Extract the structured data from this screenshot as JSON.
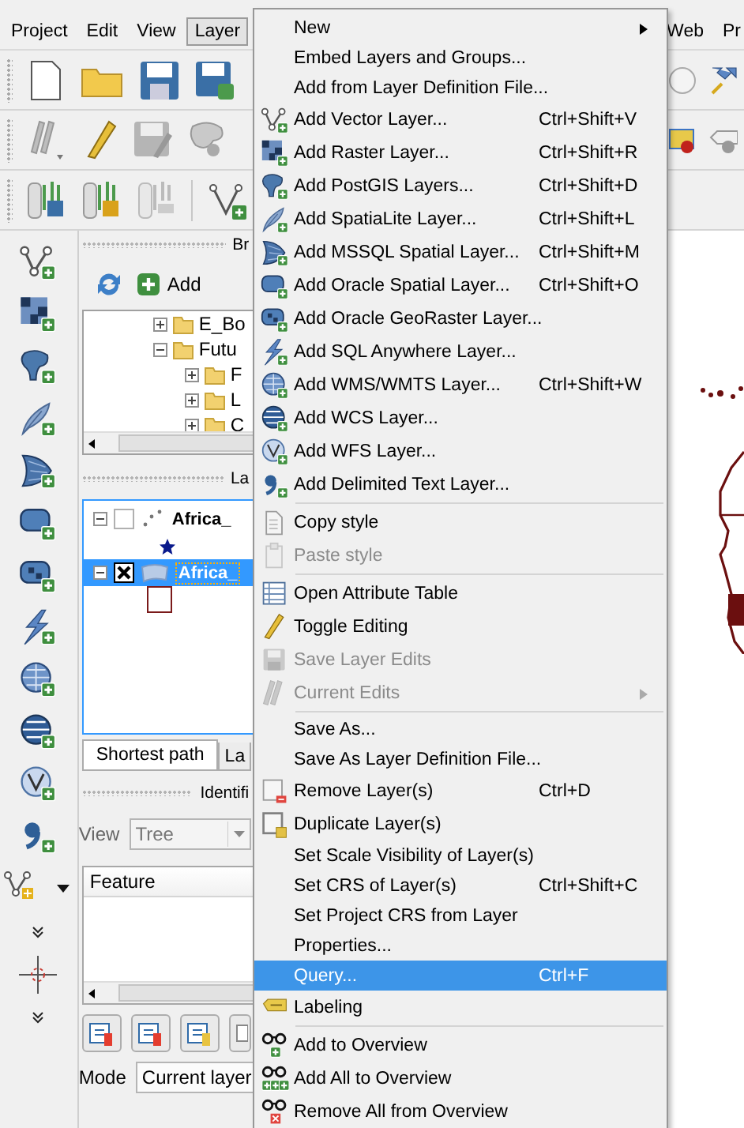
{
  "menubar": [
    {
      "label": "Project",
      "selected": false
    },
    {
      "label": "Edit",
      "selected": false
    },
    {
      "label": "View",
      "selected": false
    },
    {
      "label": "Layer",
      "selected": true
    },
    {
      "label": "Web",
      "selected": false
    },
    {
      "label": "Pr",
      "selected": false
    }
  ],
  "browser_panel": {
    "title": "Br",
    "add_button": "Add",
    "tree": [
      {
        "label": "E_Bo",
        "expanded": false
      },
      {
        "label": "Futu",
        "expanded": true,
        "children": [
          {
            "label": "F",
            "expanded": false
          },
          {
            "label": "L",
            "expanded": false
          },
          {
            "label": "C",
            "expanded": false
          }
        ]
      }
    ]
  },
  "layers_panel": {
    "title": "La",
    "layers": [
      {
        "label": "Africa_",
        "kind": "point",
        "checked": false,
        "selected": false
      },
      {
        "label": "Africa_",
        "kind": "polygon",
        "checked": true,
        "selected": true
      }
    ]
  },
  "dock_tabs": [
    {
      "label": "Shortest path",
      "selected": true
    },
    {
      "label": "La",
      "selected": false
    }
  ],
  "identify_panel": {
    "title": "Identifi",
    "view_label": "View",
    "view_value": "Tree",
    "table_header": "Feature",
    "mode_label": "Mode",
    "mode_value": "Current layer"
  },
  "layer_menu": [
    {
      "kind": "item",
      "label": "New",
      "disabled": false,
      "selected": false,
      "submenu": true
    },
    {
      "kind": "item",
      "label": "Embed Layers and Groups...",
      "disabled": false,
      "selected": false,
      "submenu": false
    },
    {
      "kind": "item",
      "label": "Add from Layer Definition File...",
      "disabled": false,
      "selected": false,
      "submenu": false
    },
    {
      "kind": "item",
      "label": "Add Vector Layer...",
      "shortcut": "Ctrl+Shift+V",
      "disabled": false,
      "selected": false,
      "submenu": false
    },
    {
      "kind": "item",
      "label": "Add Raster Layer...",
      "shortcut": "Ctrl+Shift+R",
      "disabled": false,
      "selected": false,
      "submenu": false
    },
    {
      "kind": "item",
      "label": "Add PostGIS Layers...",
      "shortcut": "Ctrl+Shift+D",
      "disabled": false,
      "selected": false,
      "submenu": false
    },
    {
      "kind": "item",
      "label": "Add SpatiaLite Layer...",
      "shortcut": "Ctrl+Shift+L",
      "disabled": false,
      "selected": false,
      "submenu": false
    },
    {
      "kind": "item",
      "label": "Add MSSQL Spatial Layer...",
      "shortcut": "Ctrl+Shift+M",
      "disabled": false,
      "selected": false,
      "submenu": false
    },
    {
      "kind": "item",
      "label": "Add Oracle Spatial Layer...",
      "shortcut": "Ctrl+Shift+O",
      "disabled": false,
      "selected": false,
      "submenu": false
    },
    {
      "kind": "item",
      "label": "Add Oracle GeoRaster Layer...",
      "disabled": false,
      "selected": false,
      "submenu": false
    },
    {
      "kind": "item",
      "label": "Add SQL Anywhere Layer...",
      "disabled": false,
      "selected": false,
      "submenu": false
    },
    {
      "kind": "item",
      "label": "Add WMS/WMTS Layer...",
      "shortcut": "Ctrl+Shift+W",
      "disabled": false,
      "selected": false,
      "submenu": false
    },
    {
      "kind": "item",
      "label": "Add WCS Layer...",
      "disabled": false,
      "selected": false,
      "submenu": false
    },
    {
      "kind": "item",
      "label": "Add WFS Layer...",
      "disabled": false,
      "selected": false,
      "submenu": false
    },
    {
      "kind": "item",
      "label": "Add Delimited Text Layer...",
      "disabled": false,
      "selected": false,
      "submenu": false
    },
    {
      "kind": "separator"
    },
    {
      "kind": "item",
      "label": "Copy style",
      "disabled": false,
      "selected": false,
      "submenu": false
    },
    {
      "kind": "item",
      "label": "Paste style",
      "disabled": true,
      "selected": false,
      "submenu": false
    },
    {
      "kind": "separator"
    },
    {
      "kind": "item",
      "label": "Open Attribute Table",
      "disabled": false,
      "selected": false,
      "submenu": false
    },
    {
      "kind": "item",
      "label": "Toggle Editing",
      "disabled": false,
      "selected": false,
      "submenu": false
    },
    {
      "kind": "item",
      "label": "Save Layer Edits",
      "disabled": true,
      "selected": false,
      "submenu": false
    },
    {
      "kind": "item",
      "label": "Current Edits",
      "disabled": true,
      "selected": false,
      "submenu": true
    },
    {
      "kind": "separator"
    },
    {
      "kind": "item",
      "label": "Save As...",
      "disabled": false,
      "selected": false,
      "submenu": false
    },
    {
      "kind": "item",
      "label": "Save As Layer Definition File...",
      "disabled": false,
      "selected": false,
      "submenu": false
    },
    {
      "kind": "item",
      "label": "Remove Layer(s)",
      "shortcut": "Ctrl+D",
      "disabled": false,
      "selected": false,
      "submenu": false
    },
    {
      "kind": "item",
      "label": "Duplicate Layer(s)",
      "disabled": false,
      "selected": false,
      "submenu": false
    },
    {
      "kind": "item",
      "label": "Set Scale Visibility of Layer(s)",
      "disabled": false,
      "selected": false,
      "submenu": false
    },
    {
      "kind": "item",
      "label": "Set CRS of Layer(s)",
      "shortcut": "Ctrl+Shift+C",
      "disabled": false,
      "selected": false,
      "submenu": false
    },
    {
      "kind": "item",
      "label": "Set Project CRS from Layer",
      "disabled": false,
      "selected": false,
      "submenu": false
    },
    {
      "kind": "item",
      "label": "Properties...",
      "disabled": false,
      "selected": false,
      "submenu": false
    },
    {
      "kind": "item",
      "label": "Query...",
      "shortcut": "Ctrl+F",
      "disabled": false,
      "selected": true,
      "submenu": false
    },
    {
      "kind": "item",
      "label": "Labeling",
      "disabled": false,
      "selected": false,
      "submenu": false
    },
    {
      "kind": "separator"
    },
    {
      "kind": "item",
      "label": "Add to Overview",
      "disabled": false,
      "selected": false,
      "submenu": false
    },
    {
      "kind": "item",
      "label": "Add All to Overview",
      "disabled": false,
      "selected": false,
      "submenu": false
    },
    {
      "kind": "item",
      "label": "Remove All from Overview",
      "disabled": false,
      "selected": false,
      "submenu": false
    }
  ]
}
